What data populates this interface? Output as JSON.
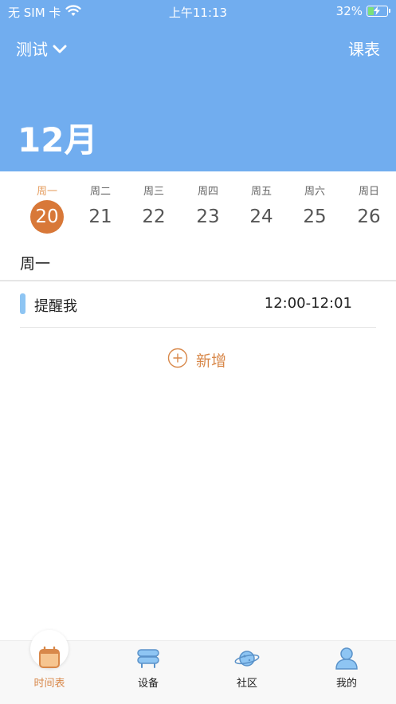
{
  "status_bar": {
    "carrier": "无 SIM 卡",
    "time": "上午11:13",
    "battery": "32%",
    "battery_level": 0.32
  },
  "header": {
    "title": "测试",
    "course_button": "课表",
    "month": "12月",
    "background_color": "#71adef"
  },
  "week": {
    "days": [
      {
        "label": "周一",
        "num": "20",
        "active": true
      },
      {
        "label": "周二",
        "num": "21",
        "active": false
      },
      {
        "label": "周三",
        "num": "22",
        "active": false
      },
      {
        "label": "周四",
        "num": "23",
        "active": false
      },
      {
        "label": "周五",
        "num": "24",
        "active": false
      },
      {
        "label": "周六",
        "num": "25",
        "active": false
      },
      {
        "label": "周日",
        "num": "26",
        "active": false
      }
    ],
    "active_color": "#d87838"
  },
  "selected_day": "周一",
  "events": [
    {
      "title": "提醒我",
      "time": "12:00-12:01",
      "color": "#8ec5f3"
    }
  ],
  "add_button": {
    "label": "新增",
    "icon": "plus-circle-icon"
  },
  "tabbar": {
    "tabs": [
      {
        "label": "时间表",
        "icon": "calendar-icon",
        "active": true
      },
      {
        "label": "设备",
        "icon": "device-icon",
        "active": false
      },
      {
        "label": "社区",
        "icon": "planet-icon",
        "active": false
      },
      {
        "label": "我的",
        "icon": "user-icon",
        "active": false
      }
    ],
    "accent_color": "#d8884a"
  }
}
